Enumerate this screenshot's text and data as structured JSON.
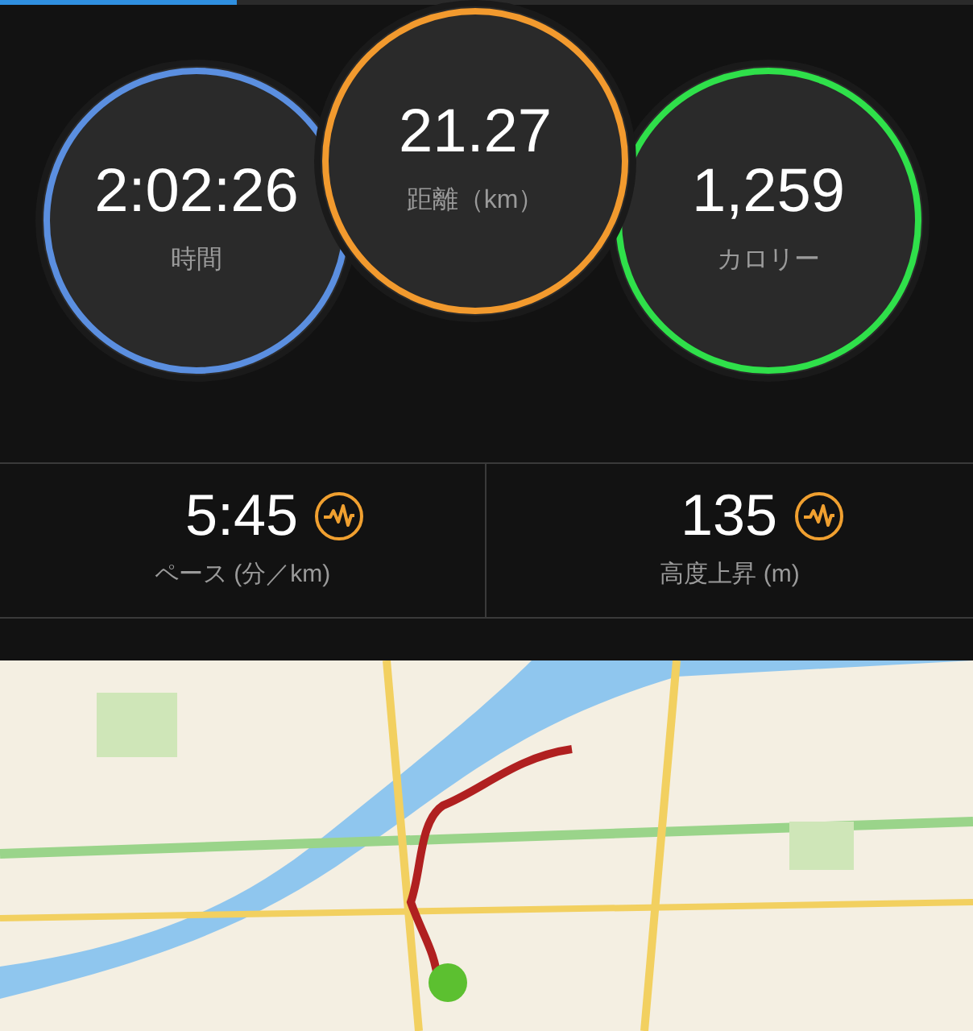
{
  "summary_circles": [
    {
      "value": "2:02:26",
      "label": "時間",
      "color": "#5b8fe0"
    },
    {
      "value": "21.27",
      "label": "距離（km）",
      "color": "#f29a2e"
    },
    {
      "value": "1,259",
      "label": "カロリー",
      "color": "#2fe04a"
    }
  ],
  "stats": [
    {
      "value": "5:45",
      "label": "ペース (分／km)"
    },
    {
      "value": "135",
      "label": "高度上昇 (m)"
    }
  ]
}
